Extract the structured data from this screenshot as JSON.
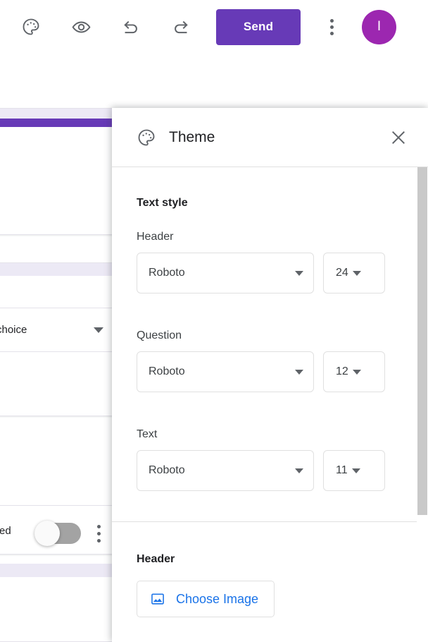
{
  "toolbar": {
    "items": [
      {
        "name": "theme-icon",
        "label": "Theme"
      },
      {
        "name": "preview-icon",
        "label": "Preview"
      },
      {
        "name": "undo-icon",
        "label": "Undo"
      },
      {
        "name": "redo-icon",
        "label": "Redo"
      }
    ],
    "send_label": "Send",
    "more_label": "More options",
    "avatar_initial": "I"
  },
  "panel": {
    "title": "Theme",
    "icon": "palette-icon",
    "close_label": "✕",
    "text_style": {
      "heading": "Text style",
      "rows": [
        {
          "label": "Header",
          "font": "Roboto",
          "size": "24"
        },
        {
          "label": "Question",
          "font": "Roboto",
          "size": "12"
        },
        {
          "label": "Text",
          "font": "Roboto",
          "size": "11"
        }
      ]
    },
    "header_section": {
      "heading": "Header",
      "choose_image_label": "Choose Image"
    }
  },
  "background_form": {
    "question_type": "choice",
    "required_label": "red"
  },
  "colors": {
    "brand_purple": "#673ab7",
    "avatar_purple": "#9c27b0",
    "link_blue": "#1a73e8",
    "lavender_band": "#ece9f5",
    "icon_gray": "#5f6368",
    "border_gray": "#e0e0e0"
  }
}
